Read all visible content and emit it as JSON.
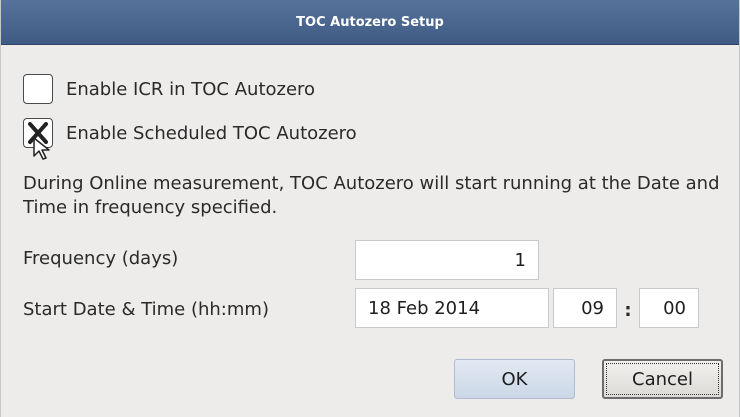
{
  "dialog": {
    "title": "TOC Autozero Setup"
  },
  "options": {
    "enable_icr": {
      "label": "Enable ICR in TOC Autozero",
      "checked": false
    },
    "enable_scheduled": {
      "label": "Enable Scheduled TOC Autozero",
      "checked": true
    }
  },
  "description": "During Online measurement, TOC Autozero will start running at the Date and Time in frequency specified.",
  "frequency": {
    "label": "Frequency (days)",
    "value": "1"
  },
  "start": {
    "label": "Start Date & Time (hh:mm)",
    "date": "18 Feb 2014",
    "hour": "09",
    "separator": ":",
    "minute": "00"
  },
  "buttons": {
    "ok": "OK",
    "cancel": "Cancel"
  },
  "icons": {
    "checkmark": "x-check-icon",
    "cursor": "mouse-pointer-icon"
  },
  "colors": {
    "titlebar": "#4a668f",
    "dialog_bg": "#edeceb",
    "ok_button": "#d3deec"
  }
}
